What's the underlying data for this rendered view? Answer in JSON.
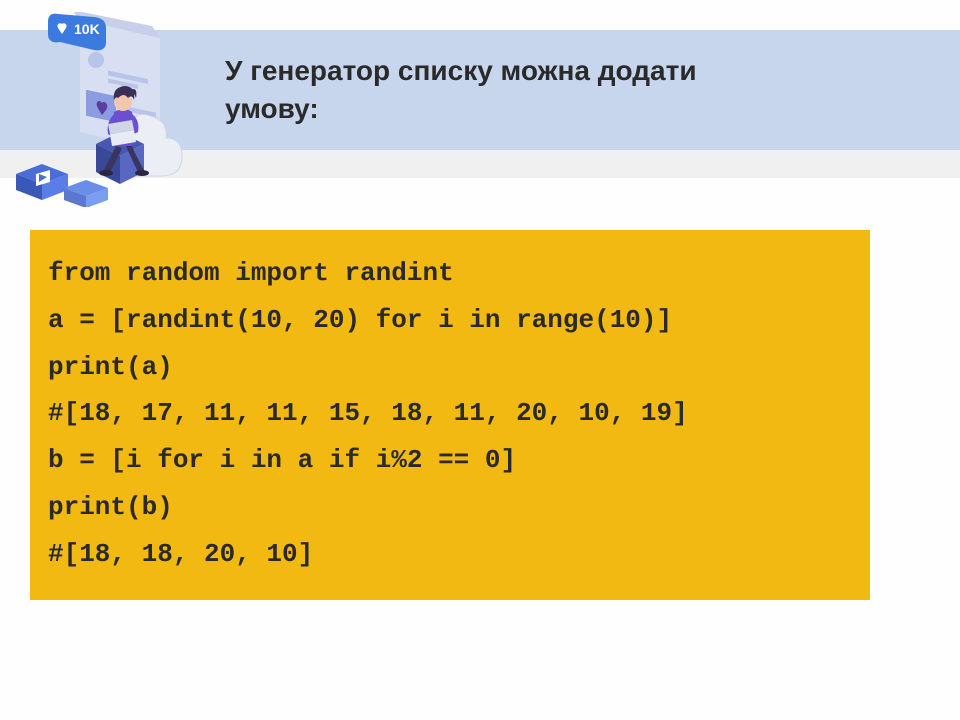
{
  "title_line1": "У генератор списку можна додати",
  "title_line2": "умову:",
  "code": {
    "l1": "from random import randint",
    "l2": "a = [randint(10, 20) for i in range(10)]",
    "l3": "print(a)",
    "l4": "#[18, 17, 11, 11, 15, 18, 11, 20, 10, 19]",
    "l5": "b = [i for i in a if i%2 == 0]",
    "l6": "print(b)",
    "l7": "#[18, 18, 20, 10]"
  },
  "illustration": {
    "badge_text": "10K"
  }
}
